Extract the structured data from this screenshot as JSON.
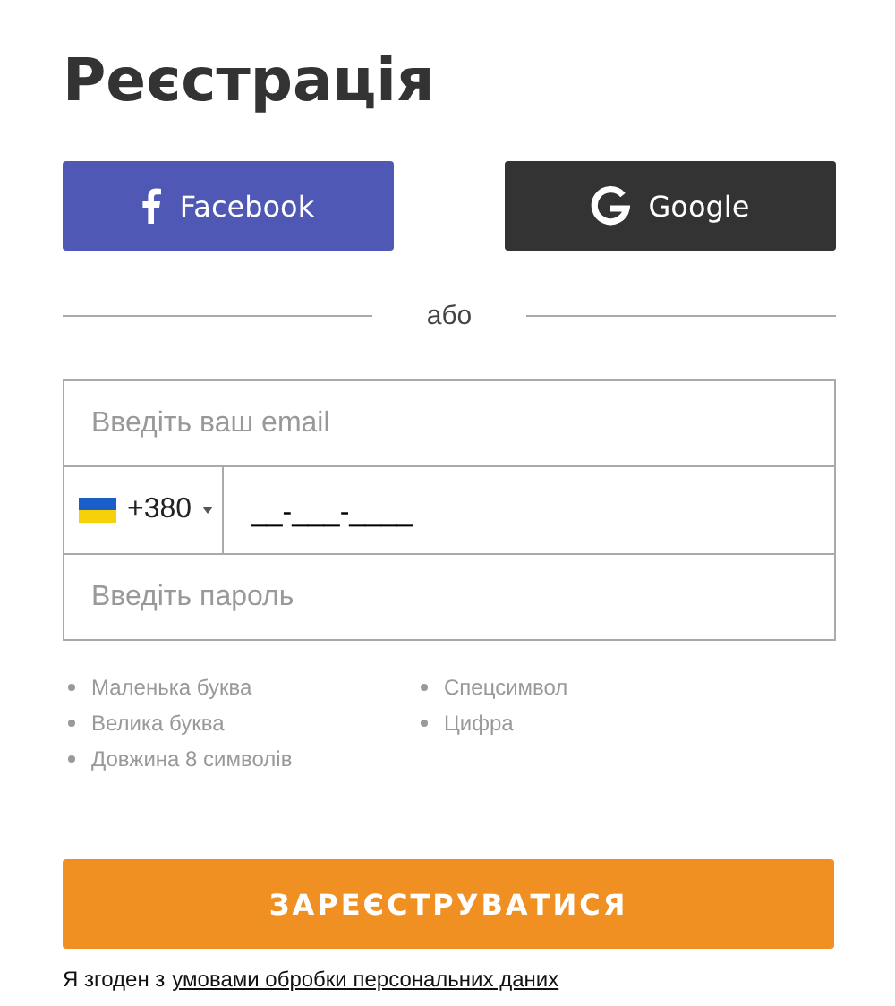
{
  "title": "Реєстрація",
  "social_buttons": [
    {
      "kind": "facebook",
      "label": "Facebook"
    },
    {
      "kind": "google",
      "label": "Google"
    }
  ],
  "divider_text": "або",
  "email_field": {
    "placeholder": "Введіть ваш email"
  },
  "phone_field": {
    "country_code": "+380",
    "value": "__-___-____"
  },
  "password_field": {
    "placeholder": "Введіть пароль"
  },
  "password_hints": [
    [
      "Маленька буква",
      "Велика буква",
      "Довжина 8 символів"
    ],
    [
      "Спецсимвол",
      "Цифра"
    ]
  ],
  "submit_button": "ЗАРЕЄСТРУВАТИСЯ",
  "consent": {
    "text": "Я згоден з",
    "link": "умовами обробки персональних даних"
  }
}
